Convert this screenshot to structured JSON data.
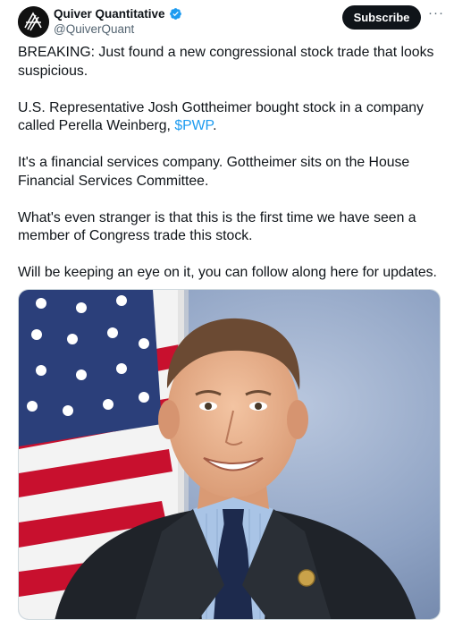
{
  "author": {
    "display_name": "Quiver Quantitative",
    "handle": "@QuiverQuant",
    "avatar_icon": "quiver-logo-icon",
    "verified_icon": "verified-badge-icon"
  },
  "actions": {
    "subscribe_label": "Subscribe",
    "more_label": "···"
  },
  "tweet": {
    "p1": "BREAKING: Just found a new congressional stock trade that looks suspicious.",
    "p2_before": "U.S. Representative Josh Gottheimer bought stock in a company called Perella Weinberg, ",
    "p2_cashtag": "$PWP",
    "p2_after": ".",
    "p3": "It's a financial services company. Gottheimer sits on the House Financial Services Committee.",
    "p4": "What's even stranger is that this is the first time we have seen a member of Congress trade this stock.",
    "p5": "Will be keeping an eye on it, you can follow along here for updates."
  },
  "colors": {
    "accent": "#1d9bf0",
    "text": "#0f1419",
    "muted": "#536471"
  }
}
